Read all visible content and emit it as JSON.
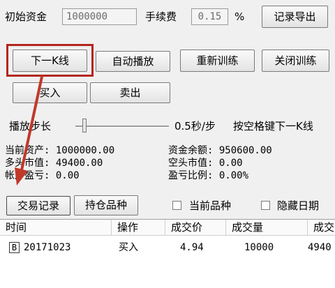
{
  "top_row": {
    "initial_capital_label": "初始资金",
    "initial_capital_value": "1000000",
    "fee_label": "手续费",
    "fee_value": "0.15",
    "percent_sign": "%",
    "export_button": "记录导出"
  },
  "controls": {
    "next_k_button": "下一K线",
    "autoplay_button": "自动播放",
    "retrain_button": "重新训练",
    "close_training_button": "关闭训练",
    "buy_button": "买入",
    "sell_button": "卖出"
  },
  "playback": {
    "step_label": "播放步长",
    "step_value": "0.5秒/步",
    "hint": "按空格键下一K线",
    "slider_level": 0.05
  },
  "stats": {
    "current_assets": "当前资产: 1000000.00",
    "long_market_value": "多头市值: 49400.00",
    "account_pnl": "帐户盈亏: 0.00",
    "cash_balance": "资金余额: 950600.00",
    "short_market_value": "空头市值: 0.00",
    "pnl_ratio": "盈亏比例: 0.00%"
  },
  "tabs": {
    "trade_records": "交易记录",
    "positions": "持仓品种",
    "current_symbol_checkbox": "当前品种",
    "hide_date_checkbox": "隐藏日期"
  },
  "table": {
    "headers": [
      "时间",
      "操作",
      "成交价",
      "成交量",
      "成交"
    ],
    "rows": [
      {
        "badge": "B",
        "date": "20171023",
        "action": "买入",
        "price": "4.94",
        "volume": "10000",
        "amount": "4940"
      }
    ]
  },
  "colors": {
    "highlight_box": "#b3261e",
    "arrow": "#c0392b",
    "badge_border": "#3a3a3a"
  }
}
